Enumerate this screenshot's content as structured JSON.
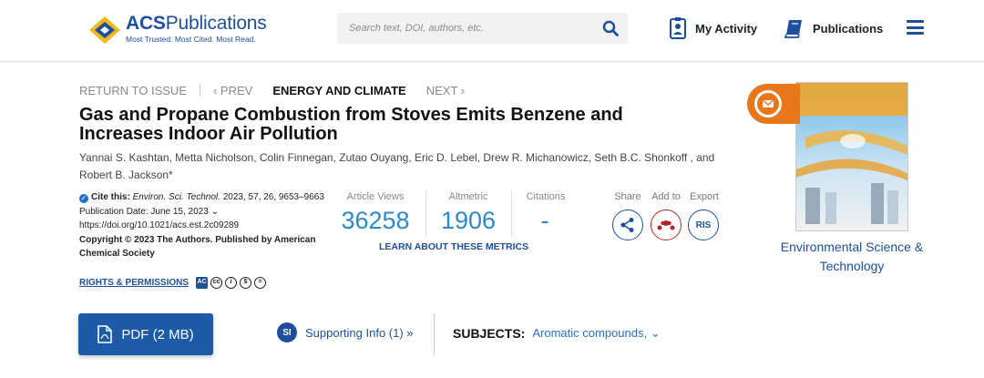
{
  "header": {
    "logo_title_bold": "ACS",
    "logo_title_rest": "Publications",
    "logo_tagline": "Most Trusted. Most Cited. Most Read.",
    "search_placeholder": "Search text, DOI, authors, etc.",
    "nav": {
      "activity": "My Activity",
      "publications": "Publications"
    }
  },
  "breadcrumb": {
    "return": "RETURN TO ISSUE",
    "prev": "‹ PREV",
    "issue": "ENERGY AND CLIMATE",
    "next": "NEXT ›"
  },
  "article": {
    "title": "Gas and Propane Combustion from Stoves Emits Benzene and Increases Indoor Air Pollution",
    "authors": "Yannai S. Kashtan, Metta Nicholson, Colin Finnegan, Zutao Ouyang, Eric D. Lebel, Drew R. Michanowicz, Seth B.C. Shonkoff , and Robert B. Jackson*"
  },
  "citation": {
    "label": "Cite this:",
    "journal": "Environ. Sci. Technol.",
    "ref": " 2023, 57, 26, 9653–9663",
    "pub_date": "Publication Date: June 15, 2023 ⌄",
    "doi": "https://doi.org/10.1021/acs.est.2c09289",
    "copyright": "Copyright © 2023 The Authors. Published by American Chemical Society",
    "rights": "RIGHTS & PERMISSIONS",
    "license_icons": [
      "AC",
      "cc",
      "i",
      "$",
      "="
    ]
  },
  "metrics": {
    "views_label": "Article Views",
    "views": "36258",
    "altmetric_label": "Altmetric",
    "altmetric": "1906",
    "citations_label": "Citations",
    "citations": "-",
    "learn_more": "LEARN ABOUT THESE METRICS"
  },
  "actions": {
    "share_label": "Share",
    "add_label": "Add to",
    "export_label": "Export",
    "export_btn": "RIS"
  },
  "journal": {
    "name": "Environmental Science & Technology",
    "cover_title": "Environmental Science & Technology"
  },
  "bottom": {
    "pdf": "PDF (2 MB)",
    "si_badge": "SI",
    "supporting": "Supporting Info (1) »",
    "subjects_label": "SUBJECTS:",
    "subjects_value": "Aromatic compounds, ⌄"
  },
  "colors": {
    "brand_blue": "#1d4f9c",
    "metric_blue": "#2a8ad0",
    "accent_orange": "#e8761a",
    "pdf_blue": "#1d5ba8"
  }
}
